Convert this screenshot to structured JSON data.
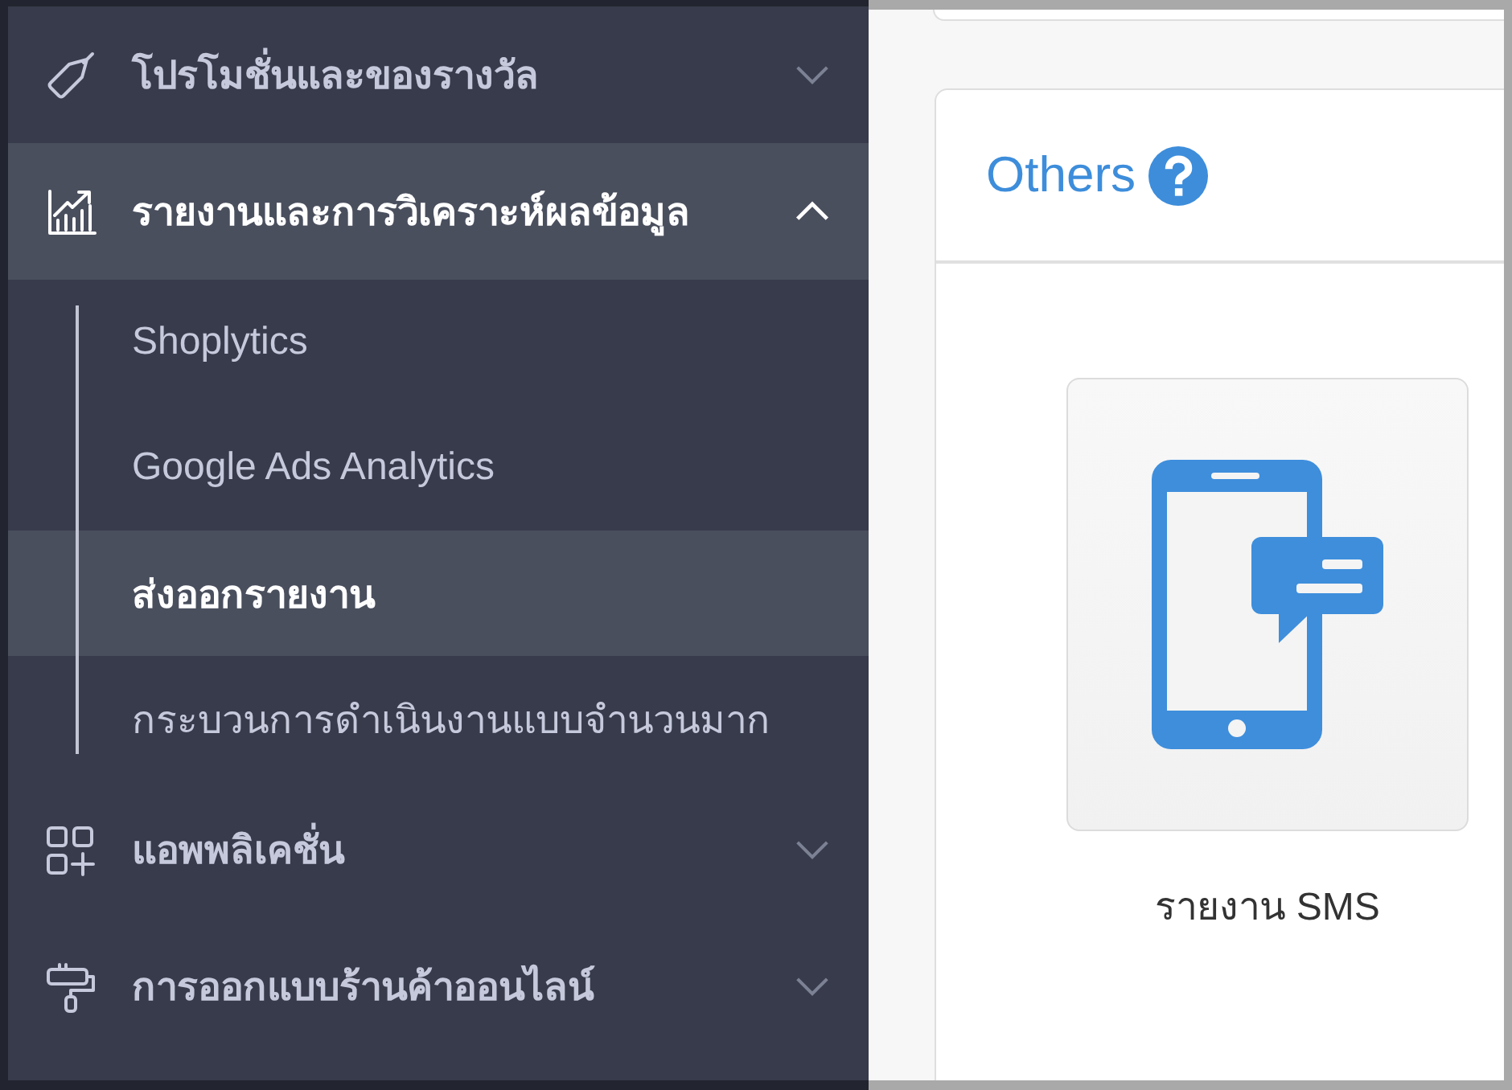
{
  "sidebar": {
    "items": [
      {
        "label": "โปรโมชั่นและของรางวัล",
        "selected": false,
        "expanded": false
      },
      {
        "label": "รายงานและการวิเคราะห์ผลข้อมูล",
        "selected": true,
        "expanded": true,
        "children": [
          {
            "label": "Shoplytics",
            "selected": false
          },
          {
            "label": "Google Ads Analytics",
            "selected": false
          },
          {
            "label": "ส่งออกรายงาน",
            "selected": true
          },
          {
            "label": "กระบวนการดำเนินงานแบบจำนวนมาก",
            "selected": false
          }
        ]
      },
      {
        "label": "แอพพลิเคชั่น",
        "selected": false,
        "expanded": false
      },
      {
        "label": "การออกแบบร้านค้าออนไลน์",
        "selected": false,
        "expanded": false
      }
    ]
  },
  "panel": {
    "title": "Others",
    "tiles": [
      {
        "label": "รายงาน SMS"
      }
    ]
  }
}
